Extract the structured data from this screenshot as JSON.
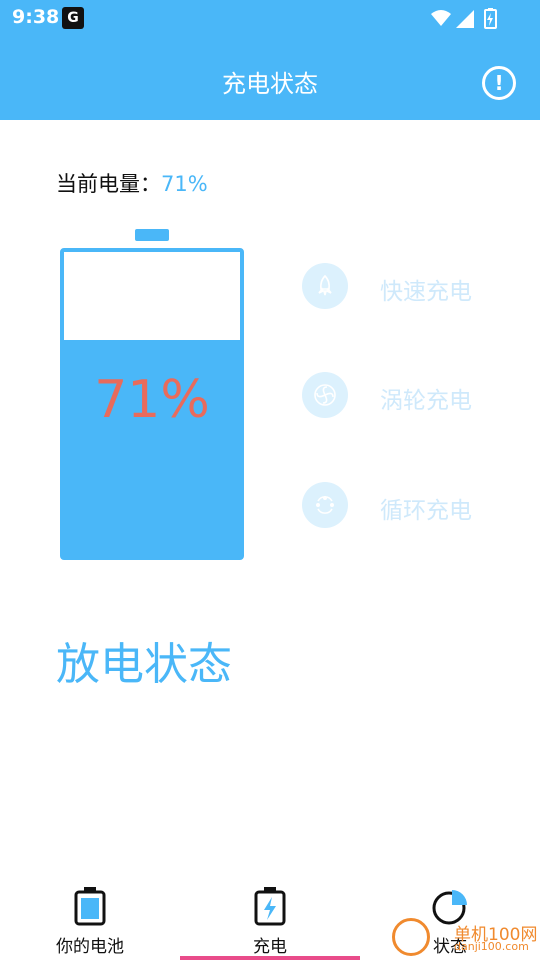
{
  "status_bar": {
    "time": "9:38",
    "notification_icon": "G"
  },
  "header": {
    "title": "充电状态",
    "info_icon": "!"
  },
  "battery": {
    "current_label": "当前电量：",
    "current_value": "71%",
    "level_percent": 71,
    "display_text": "71%"
  },
  "modes": [
    {
      "label": "快速充电",
      "icon": "rocket-icon"
    },
    {
      "label": "涡轮充电",
      "icon": "turbine-icon"
    },
    {
      "label": "循环充电",
      "icon": "cycle-icon"
    }
  ],
  "discharge": {
    "title": "放电状态"
  },
  "bottom_nav": {
    "items": [
      {
        "label": "你的电池",
        "icon": "battery-icon"
      },
      {
        "label": "充电",
        "icon": "charging-icon"
      },
      {
        "label": "状态",
        "icon": "pie-chart-icon"
      }
    ],
    "active_index": 1
  },
  "watermark": {
    "text": "单机100网",
    "subtext": "danji100.com"
  },
  "colors": {
    "primary": "#4ab7f8",
    "battery_text": "#e86b5c",
    "indicator": "#e94c8a"
  }
}
